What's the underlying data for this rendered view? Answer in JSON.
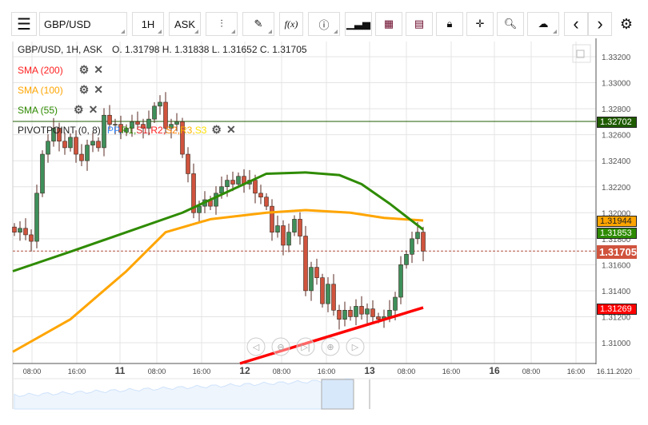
{
  "toolbar": {
    "menu": "☰",
    "symbol": "GBP/USD",
    "timeframe": "1H",
    "price_type": "ASK",
    "functions": "f(x)",
    "prev": "‹",
    "next": "›"
  },
  "legend": {
    "title": "GBP/USD, 1H, ASK",
    "ohlc": "O. 1.31798 H. 1.31838 L. 1.31652 C. 1.31705",
    "indicators": [
      {
        "label": "SMA (200)",
        "color": "#ff2020"
      },
      {
        "label": "SMA (100)",
        "color": "#ffa500"
      },
      {
        "label": "SMA (55)",
        "color": "#2e8b00"
      }
    ],
    "pivot": {
      "label": "PIVOTPOINT (0, 8)",
      "parts": [
        {
          "t": "PP",
          "c": "#3b8cff"
        },
        {
          "t": "R1",
          "c": "#2e8b00"
        },
        {
          "t": "S1",
          "c": "#e02020"
        },
        {
          "t": "R2",
          "c": "#ff2020"
        },
        {
          "t": "S2",
          "c": "#ff8000"
        },
        {
          "t": "R3",
          "c": "#ffb000"
        },
        {
          "t": "S3",
          "c": "#ffe000"
        }
      ]
    }
  },
  "price_axis": [
    "1.33200",
    "1.33000",
    "1.32800",
    "1.32600",
    "1.32400",
    "1.32200",
    "1.32000",
    "1.31800",
    "1.31600",
    "1.31400",
    "1.31200",
    "1.31000"
  ],
  "price_labels": {
    "pivot": "1.32702",
    "sma100": "1.31944",
    "sma55": "1.31853",
    "last": "1.31705",
    "sma200": "1.31269"
  },
  "time_axis": [
    "08:00",
    "16:00",
    "11",
    "08:00",
    "16:00",
    "12",
    "08:00",
    "16:00",
    "13",
    "08:00",
    "16:00",
    "16",
    "08:00",
    "16:00",
    "16.11.2020"
  ],
  "closes": [
    1.3185,
    1.3188,
    1.3183,
    1.3178,
    1.3215,
    1.3245,
    1.3255,
    1.3265,
    1.3255,
    1.325,
    1.3258,
    1.3245,
    1.324,
    1.3252,
    1.3255,
    1.325,
    1.3275,
    1.3268,
    1.3268,
    1.3262,
    1.3265,
    1.327,
    1.3268,
    1.3265,
    1.3272,
    1.3282,
    1.3285,
    1.3265,
    1.3268,
    1.327,
    1.3245,
    1.323,
    1.32,
    1.3205,
    1.321,
    1.3205,
    1.3215,
    1.322,
    1.3225,
    1.3222,
    1.3228,
    1.3222,
    1.3225,
    1.3215,
    1.3212,
    1.3205,
    1.3185,
    1.319,
    1.3175,
    1.3185,
    1.3195,
    1.3182,
    1.314,
    1.3158,
    1.315,
    1.313,
    1.3145,
    1.3125,
    1.3118,
    1.3125,
    1.312,
    1.3128,
    1.3122,
    1.3126,
    1.312,
    1.3118,
    1.312,
    1.3125,
    1.3135,
    1.316,
    1.3168,
    1.318,
    1.3185,
    1.31705
  ],
  "sma55": [
    [
      -1,
      1.3155
    ],
    [
      10,
      1.317
    ],
    [
      20,
      1.3185
    ],
    [
      30,
      1.32
    ],
    [
      40,
      1.322
    ],
    [
      45,
      1.323
    ],
    [
      52,
      1.3231
    ],
    [
      58,
      1.3229
    ],
    [
      62,
      1.3222
    ],
    [
      67,
      1.3207
    ],
    [
      73,
      1.3187
    ]
  ],
  "sma100": [
    [
      -1,
      1.3093
    ],
    [
      10,
      1.3118
    ],
    [
      20,
      1.3155
    ],
    [
      27,
      1.3185
    ],
    [
      35,
      1.3195
    ],
    [
      45,
      1.32
    ],
    [
      52,
      1.3202
    ],
    [
      60,
      1.32
    ],
    [
      66,
      1.3196
    ],
    [
      73,
      1.3194
    ]
  ],
  "sma200": [
    [
      40,
      1.3096
    ],
    [
      73,
      1.3127
    ]
  ],
  "colors": {
    "up": "#3f8f5a",
    "down": "#d0533d",
    "sma55": "#2e8b00",
    "sma100": "#ffa500",
    "sma200": "#ff0000",
    "pivot": "#1f5c00"
  }
}
